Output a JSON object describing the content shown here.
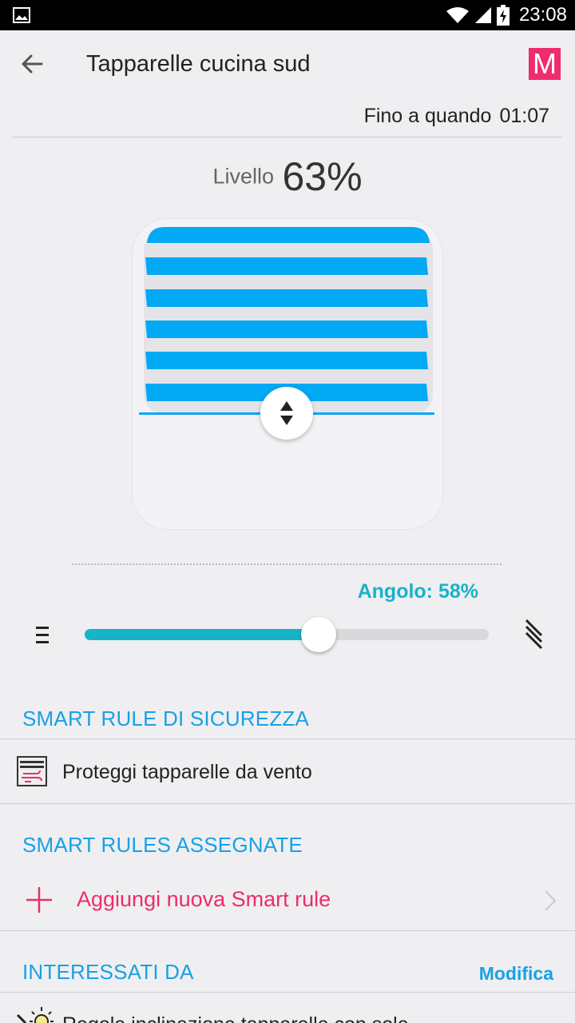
{
  "status_bar": {
    "time": "23:08",
    "icons": [
      "gallery-icon",
      "wifi-icon",
      "signal-icon",
      "battery-charging-icon"
    ]
  },
  "header": {
    "title": "Tapparelle cucina sud",
    "logo_letter": "M",
    "logo_color": "#ee2d6c"
  },
  "until": {
    "label": "Fino a quando",
    "time": "01:07"
  },
  "level": {
    "label": "Livello",
    "value": "63%",
    "fraction": 0.63
  },
  "angle": {
    "label": "Angolo: 58%",
    "fraction": 0.58
  },
  "sections": {
    "security": {
      "title": "SMART RULE DI SICUREZZA",
      "item": "Proteggi tapparelle da vento"
    },
    "assigned": {
      "title": "SMART RULES ASSEGNATE",
      "add_label": "Aggiungi nuova Smart rule"
    },
    "affected": {
      "title": "INTERESSATI DA",
      "edit_label": "Modifica",
      "item": "Regola inclinazione tapparelle con sole"
    }
  },
  "colors": {
    "accent_blue": "#19a0e6",
    "slat_blue": "#03a9f4",
    "teal": "#17b3c9",
    "pink": "#ec2e67"
  }
}
